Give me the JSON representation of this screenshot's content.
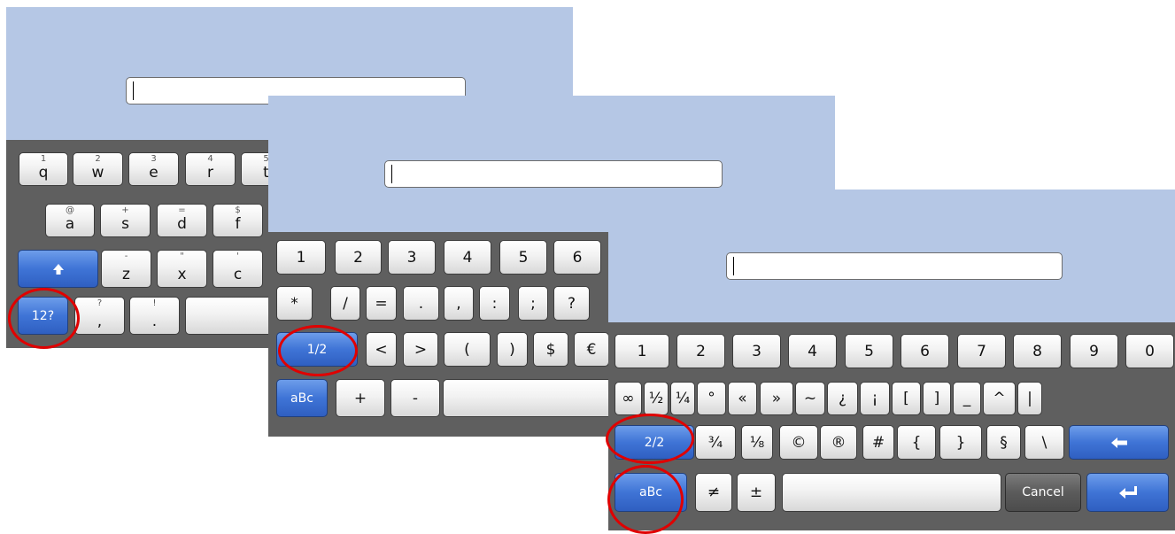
{
  "screens": [
    {
      "input_value": "",
      "rows": [
        {
          "keys": [
            {
              "main": "q",
              "sub": "1"
            },
            {
              "main": "w",
              "sub": "2"
            },
            {
              "main": "e",
              "sub": "3"
            },
            {
              "main": "r",
              "sub": "4"
            },
            {
              "main": "t",
              "sub": "5"
            }
          ]
        },
        {
          "keys": [
            {
              "main": "a",
              "sub": "@"
            },
            {
              "main": "s",
              "sub": "+"
            },
            {
              "main": "d",
              "sub": "="
            },
            {
              "main": "f",
              "sub": "$"
            }
          ]
        },
        {
          "keys": [
            {
              "main": "",
              "icon": "shift-arrow-icon",
              "blue": true
            },
            {
              "main": "z",
              "sub": "-"
            },
            {
              "main": "x",
              "sub": "\""
            },
            {
              "main": "c",
              "sub": "'"
            }
          ]
        },
        {
          "keys": [
            {
              "main": "12?",
              "blue": true,
              "circled": true
            },
            {
              "main": ",",
              "sub": "?"
            },
            {
              "main": ".",
              "sub": "!"
            },
            {
              "main": "",
              "space": true
            }
          ]
        }
      ]
    },
    {
      "input_value": "",
      "rows": [
        {
          "keys": [
            {
              "main": "1"
            },
            {
              "main": "2"
            },
            {
              "main": "3"
            },
            {
              "main": "4"
            },
            {
              "main": "5"
            },
            {
              "main": "6"
            }
          ]
        },
        {
          "keys": [
            {
              "main": "*"
            },
            {
              "main": "/"
            },
            {
              "main": "="
            },
            {
              "main": "."
            },
            {
              "main": ","
            },
            {
              "main": ":"
            },
            {
              "main": ";"
            },
            {
              "main": "?"
            }
          ]
        },
        {
          "keys": [
            {
              "main": "1/2",
              "blue": true,
              "circled": true
            },
            {
              "main": "<"
            },
            {
              "main": ">"
            },
            {
              "main": "("
            },
            {
              "main": ")"
            },
            {
              "main": "$"
            },
            {
              "main": "€"
            }
          ]
        },
        {
          "keys": [
            {
              "main": "aBc",
              "blue": true
            },
            {
              "main": "+"
            },
            {
              "main": "-"
            },
            {
              "main": "",
              "space": true
            }
          ]
        }
      ]
    },
    {
      "input_value": "",
      "rows": [
        {
          "keys": [
            {
              "main": "1"
            },
            {
              "main": "2"
            },
            {
              "main": "3"
            },
            {
              "main": "4"
            },
            {
              "main": "5"
            },
            {
              "main": "6"
            },
            {
              "main": "7"
            },
            {
              "main": "8"
            },
            {
              "main": "9"
            },
            {
              "main": "0"
            }
          ]
        },
        {
          "keys": [
            {
              "main": "∞"
            },
            {
              "main": "½"
            },
            {
              "main": "¼"
            },
            {
              "main": "°"
            },
            {
              "main": "«"
            },
            {
              "main": "»"
            },
            {
              "main": "~"
            },
            {
              "main": "¿"
            },
            {
              "main": "¡"
            },
            {
              "main": "["
            },
            {
              "main": "]"
            },
            {
              "main": "_"
            },
            {
              "main": "^"
            },
            {
              "main": "|"
            }
          ]
        },
        {
          "keys": [
            {
              "main": "2/2",
              "blue": true,
              "circled": true
            },
            {
              "main": "¾"
            },
            {
              "main": "⅛"
            },
            {
              "main": "©"
            },
            {
              "main": "®"
            },
            {
              "main": "#"
            },
            {
              "main": "{"
            },
            {
              "main": "}"
            },
            {
              "main": "§"
            },
            {
              "main": "\\"
            },
            {
              "main": "",
              "icon": "backspace-arrow-icon",
              "blue": true
            }
          ]
        },
        {
          "keys": [
            {
              "main": "aBc",
              "blue": true,
              "circled": true
            },
            {
              "main": "≠"
            },
            {
              "main": "±"
            },
            {
              "main": "",
              "space": true
            },
            {
              "main": "Cancel",
              "dark": true
            },
            {
              "main": "",
              "icon": "enter-icon",
              "blue": true
            }
          ]
        }
      ]
    }
  ],
  "colors": {
    "panel_bg": "#b5c7e5",
    "keyboard_bg": "#5f5f5f",
    "accent_blue": "#3f74d6",
    "highlight_circle": "#e00000"
  }
}
